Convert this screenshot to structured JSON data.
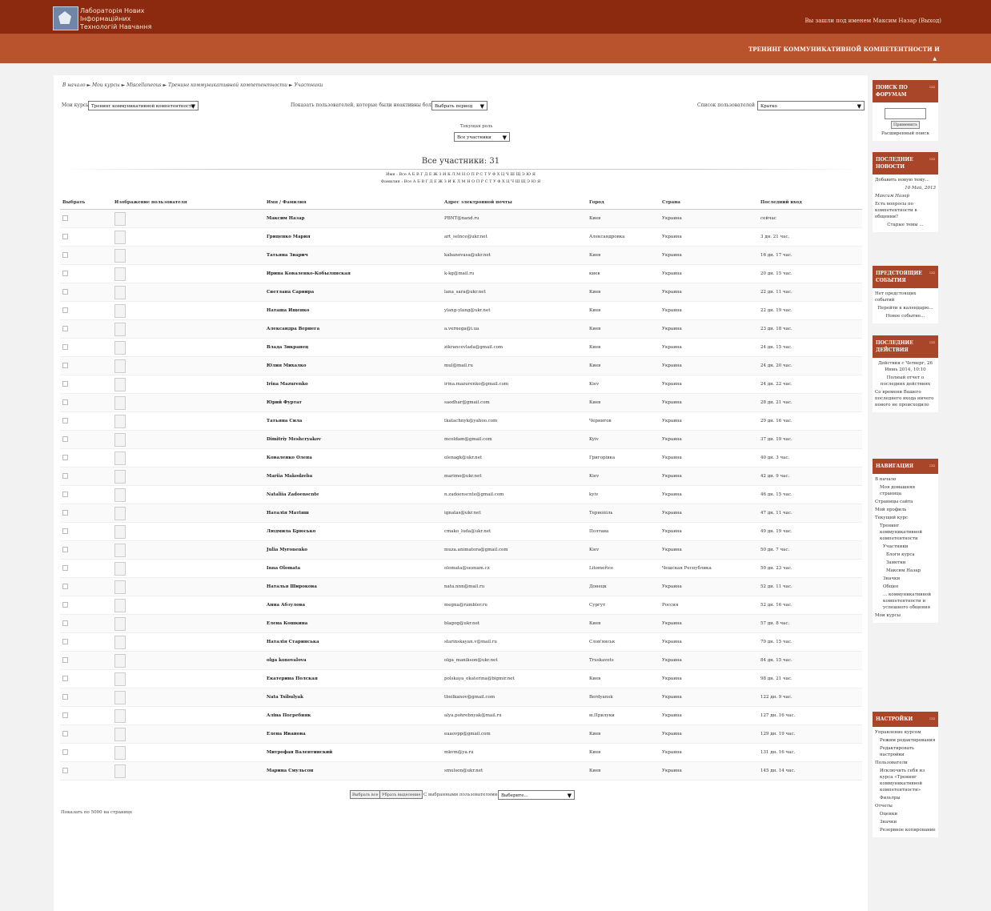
{
  "header": {
    "logo_line1": "Лабораторія Нових",
    "logo_line2": "Інформаційних",
    "logo_line3": "Технологій Навчання",
    "login_info": "Вы зашли под именем Максим Назар (Выход)",
    "course_banner": "ТРЕНИНГ КОММУНИКАТИВНОЙ КОМПЕТЕНТНОСТИ И"
  },
  "breadcrumb": "В начало ► Мои курсы ► Miscellaneous ► Тренинг коммуникативной компетентности ► Участники",
  "filters": {
    "my_courses_label": "Мои курсы",
    "my_courses_value": "Тренинг коммуникативной компетентности",
    "inactive_label": "Показать пользователей, которые были неактивны более чем",
    "inactive_value": "Выбрать период",
    "list_label": "Список пользователей",
    "list_value": "Кратко",
    "current_role_label": "Текущая роль",
    "current_role_value": "Все участники"
  },
  "participants_title": "Все участники: 31",
  "alpha_name": "Имя : Все А Б В Г Д Е Ж З И К Л М Н О П Р С Т У Ф Х Ц Ч Ш Щ Э Ю Я",
  "alpha_surname": "Фамилия : Все А Б В Г Д Е Ж З И К Л М Н О П Р С Т У Ф Х Ц Ч Ш Щ Э Ю Я",
  "table": {
    "headers": [
      "Выбрать",
      "Изображение пользователя",
      "Имя / Фамилия",
      "Адрес электронной почты",
      "Город",
      "Страна",
      "Последний вход"
    ],
    "rows": [
      {
        "name": "Максим Назар",
        "email": "PBNT@nand.ru",
        "city": "Киев",
        "country": "Украина",
        "last": "сейчас"
      },
      {
        "name": "Гриценко Мария",
        "email": "art_selnce@ukr.net",
        "city": "Александровка",
        "country": "Украина",
        "last": "3 дн. 21 час."
      },
      {
        "name": "Татьяна Зварич",
        "email": "kabanovasa@ukr.net",
        "city": "Киев",
        "country": "Украина",
        "last": "16 дн. 17 час."
      },
      {
        "name": "Ирина Коваленко-Кобылянская",
        "email": "k-kg@mail.ru",
        "city": "киев",
        "country": "Украина",
        "last": "20 дн. 15 час."
      },
      {
        "name": "Светлана Сарвира",
        "email": "lana_sara@ukr.net",
        "city": "Киев",
        "country": "Украина",
        "last": "22 дн. 11 час."
      },
      {
        "name": "Наташа Ищенко",
        "email": "ylang-ylang@ukr.net",
        "city": "Киев",
        "country": "Украина",
        "last": "22 дн. 19 час."
      },
      {
        "name": "Александра Вернега",
        "email": "a.vernega@i.ua",
        "city": "Киев",
        "country": "Украина",
        "last": "23 дн. 18 час."
      },
      {
        "name": "Влада Зикранец",
        "email": "zikrancevlada@gmail.com",
        "city": "Киев",
        "country": "Украина",
        "last": "24 дн. 15 час."
      },
      {
        "name": "Юлия Михалко",
        "email": "mul@mail.ru",
        "city": "Киев",
        "country": "Украина",
        "last": "24 дн. 20 час."
      },
      {
        "name": "Irina Mazurenko",
        "email": "irina.mazurenko@gmail.com",
        "city": "Kiev",
        "country": "Украина",
        "last": "24 дн. 22 час."
      },
      {
        "name": "Юрий Фуртат",
        "email": "saodhar@gmail.com",
        "city": "Киев",
        "country": "Украина",
        "last": "28 дн. 21 час."
      },
      {
        "name": "Татьяна Сила",
        "email": "tkatachnyk@yahoo.com",
        "city": "Чернигов",
        "country": "Украина",
        "last": "29 дн. 16 час."
      },
      {
        "name": "Dimitriy Meshcryakov",
        "email": "mcoldam@gmail.com",
        "city": "Kyiv",
        "country": "Украина",
        "last": "37 дн. 19 час."
      },
      {
        "name": "Коваленко Олена",
        "email": "olenagk@ukr.net",
        "city": "Григорівка",
        "country": "Украина",
        "last": "40 дн. 3 час."
      },
      {
        "name": "Mariia Makodzeba",
        "email": "marimo@ukr.net",
        "city": "Kiev",
        "country": "Украина",
        "last": "42 дн. 9 час."
      },
      {
        "name": "Nataliia Zadoenscnte",
        "email": "n.zadoenscnte@gmail.com",
        "city": "kyiv",
        "country": "Украина",
        "last": "46 дн. 15 час."
      },
      {
        "name": "Наталія Матіяш",
        "email": "ignatas@ukr.net",
        "city": "Тернопіль",
        "country": "Украина",
        "last": "47 дн. 11 час."
      },
      {
        "name": "Людмила Брюсько",
        "email": "cmako_luda@ukr.net",
        "city": "Полтава",
        "country": "Украина",
        "last": "49 дн. 19 час."
      },
      {
        "name": "Julia Myronenko",
        "email": "muza.animatora@gmail.com",
        "city": "Kiev",
        "country": "Украина",
        "last": "50 дн. 7 час."
      },
      {
        "name": "Inna Olomata",
        "email": "olomata@seznam.cz",
        "city": "Litomeřice",
        "country": "Чешская Республика",
        "last": "50 дн. 23 час."
      },
      {
        "name": "Наталья Широкова",
        "email": "nata.nnn@mail.ru",
        "city": "Донецк",
        "country": "Украина",
        "last": "52 дн. 11 час."
      },
      {
        "name": "Анна Абзулова",
        "email": "megna@rambler.ru",
        "city": "Сургут",
        "country": "Россия",
        "last": "52 дн. 16 час."
      },
      {
        "name": "Елена Кошкина",
        "email": "blagog@ukr.net",
        "city": "Киев",
        "country": "Украина",
        "last": "57 дн. 8 час."
      },
      {
        "name": "Наталія Старинська",
        "email": "starinskayan.v@mail.ru",
        "city": "Слов'янськ",
        "country": "Украина",
        "last": "79 дн. 15 час."
      },
      {
        "name": "olga konovalova",
        "email": "olga_manikson@ukr.net",
        "city": "Truskavets",
        "country": "Украина",
        "last": "84 дн. 15 час."
      },
      {
        "name": "Екатерина Полская",
        "email": "polskaya_ekaterina@bigmir.net",
        "city": "Киев",
        "country": "Украина",
        "last": "98 дн. 21 час."
      },
      {
        "name": "Nata Tsibulyak",
        "email": "tbsilkanov@gmail.com",
        "city": "Berdyansk",
        "country": "Украина",
        "last": "122 дн. 9 час."
      },
      {
        "name": "Аліна Погребняк",
        "email": "alya.pohrebnyak@mail.ru",
        "city": "м.Прилуки",
        "country": "Украина",
        "last": "127 дн. 16 час."
      },
      {
        "name": "Елена Иванова",
        "email": "eaaovpp@gmail.com",
        "city": "Киев",
        "country": "Украина",
        "last": "129 дн. 19 час."
      },
      {
        "name": "Митрофан Валентинский",
        "email": "mkvm@ya.ru",
        "city": "Киев",
        "country": "Украина",
        "last": "131 дн. 16 час."
      },
      {
        "name": "Марина Смульсон",
        "email": "smulson@ukr.net",
        "city": "Киев",
        "country": "Украина",
        "last": "145 дн. 14 час."
      }
    ]
  },
  "bulk": {
    "select_all": "Выбрать все",
    "deselect_all": "Убрать выделение",
    "with_selected": "С выбранными пользователями...",
    "choose": "Выберите..."
  },
  "show_all": "Показать по 5000 на странице",
  "sidebar": {
    "search": {
      "title": "ПОИСК ПО ФОРУМАМ",
      "button": "Применить",
      "advanced": "Расширенный поиск"
    },
    "news": {
      "title": "ПОСЛЕДНИЕ НОВОСТИ",
      "add": "Добавить новую тему...",
      "date": "10 Май, 2013",
      "author": "Максим Назар",
      "topic": "Есть вопросы по компетентности в общении?",
      "older": "Старые темы ..."
    },
    "events": {
      "title": "ПРЕДСТОЯЩИЕ СОБЫТИЯ",
      "none": "Нет предстоящих событий",
      "calendar": "Перейти к календарю...",
      "new": "Новое событие..."
    },
    "activity": {
      "title": "ПОСЛЕДНИЕ ДЕЙСТВИЯ",
      "since": "Действия с Четверг, 26 Июнь 2014, 10:10",
      "report": "Полный отчет о последних действиях",
      "nothing": "Со времени Вашего последнего входа ничего нового не происходило"
    },
    "navigation": {
      "title": "НАВИГАЦИЯ",
      "items": [
        "В начало",
        "Моя домашняя страница",
        "Страницы сайта",
        "Мой профиль",
        "Текущий курс",
        "Тренинг коммуникативной компетентности",
        "Участники",
        "Блоги курса",
        "Заметки",
        "Максим Назар",
        "Значки",
        "Общее",
        "... коммуникативной компетентности и успешного общения",
        "Мои курсы"
      ]
    },
    "settings": {
      "title": "НАСТРОЙКИ",
      "items": [
        "Управление курсом",
        "Режим редактирования",
        "Редактировать настройки",
        "Пользователи",
        "Исключить себя из курса «Тренинг коммуникативной компетентности»",
        "Фильтры",
        "Отчеты",
        "Оценки",
        "Значки",
        "Резервное копирование"
      ]
    }
  },
  "colors": {
    "header": "#8b2a0f",
    "navbar": "#b8532d",
    "block_header": "#a9462a"
  }
}
